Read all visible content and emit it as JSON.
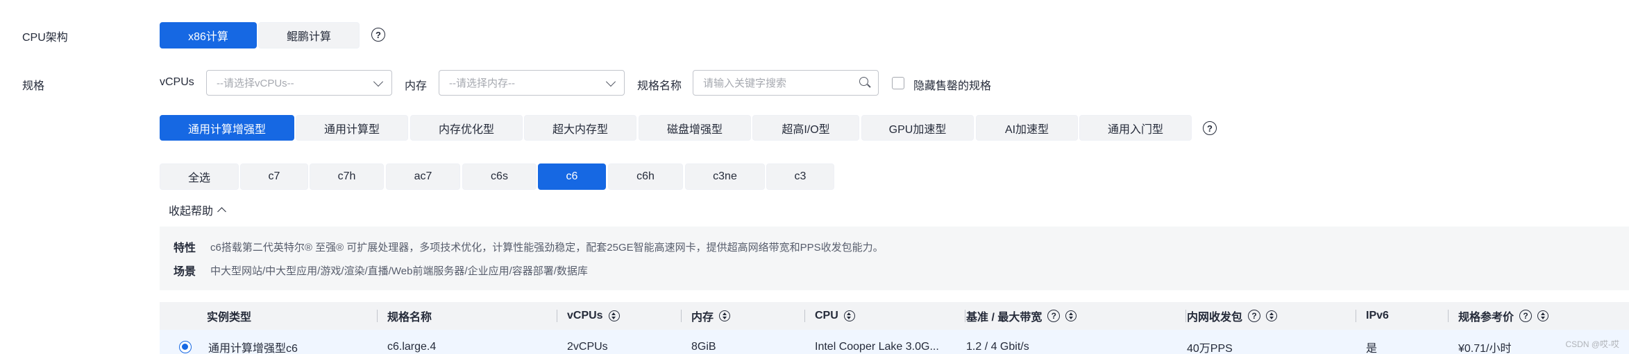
{
  "cpu_arch": {
    "label": "CPU架构",
    "options": [
      "x86计算",
      "鲲鹏计算"
    ],
    "selected": "x86计算"
  },
  "spec": {
    "label": "规格",
    "vcpus_label": "vCPUs",
    "vcpus_placeholder": "--请选择vCPUs--",
    "memory_label": "内存",
    "memory_placeholder": "--请选择内存--",
    "name_label": "规格名称",
    "name_placeholder": "请输入关键字搜索",
    "hide_soldout_label": "隐藏售罄的规格"
  },
  "types": [
    "通用计算增强型",
    "通用计算型",
    "内存优化型",
    "超大内存型",
    "磁盘增强型",
    "超高I/O型",
    "GPU加速型",
    "AI加速型",
    "通用入门型"
  ],
  "types_selected": "通用计算增强型",
  "families": [
    "全选",
    "c7",
    "c7h",
    "ac7",
    "c6s",
    "c6",
    "c6h",
    "c3ne",
    "c3"
  ],
  "families_selected": "c6",
  "collapse_help": "收起帮助",
  "help": {
    "feature_key": "特性",
    "feature_val": "c6搭载第二代英特尔® 至强® 可扩展处理器，多项技术优化，计算性能强劲稳定，配套25GE智能高速网卡，提供超高网络带宽和PPS收发包能力。",
    "scene_key": "场景",
    "scene_val": "中大型网站/中大型应用/游戏/渲染/直播/Web前端服务器/企业应用/容器部署/数据库"
  },
  "table": {
    "headers": [
      "实例类型",
      "规格名称",
      "vCPUs",
      "内存",
      "CPU",
      "基准 / 最大带宽",
      "内网收发包",
      "IPv6",
      "规格参考价"
    ],
    "rows": [
      [
        "通用计算增强型c6",
        "c6.large.4",
        "2vCPUs",
        "8GiB",
        "Intel Cooper Lake 3.0G...",
        "1.2 / 4 Gbit/s",
        "40万PPS",
        "是",
        "¥0.71/小时"
      ]
    ]
  },
  "watermark": "CSDN @哎-哎",
  "colors": {
    "accent": "#1668e3",
    "button_bg": "#f2f3f5",
    "help_bg": "#f5f6f7",
    "row_selected": "#f0f6ff"
  }
}
